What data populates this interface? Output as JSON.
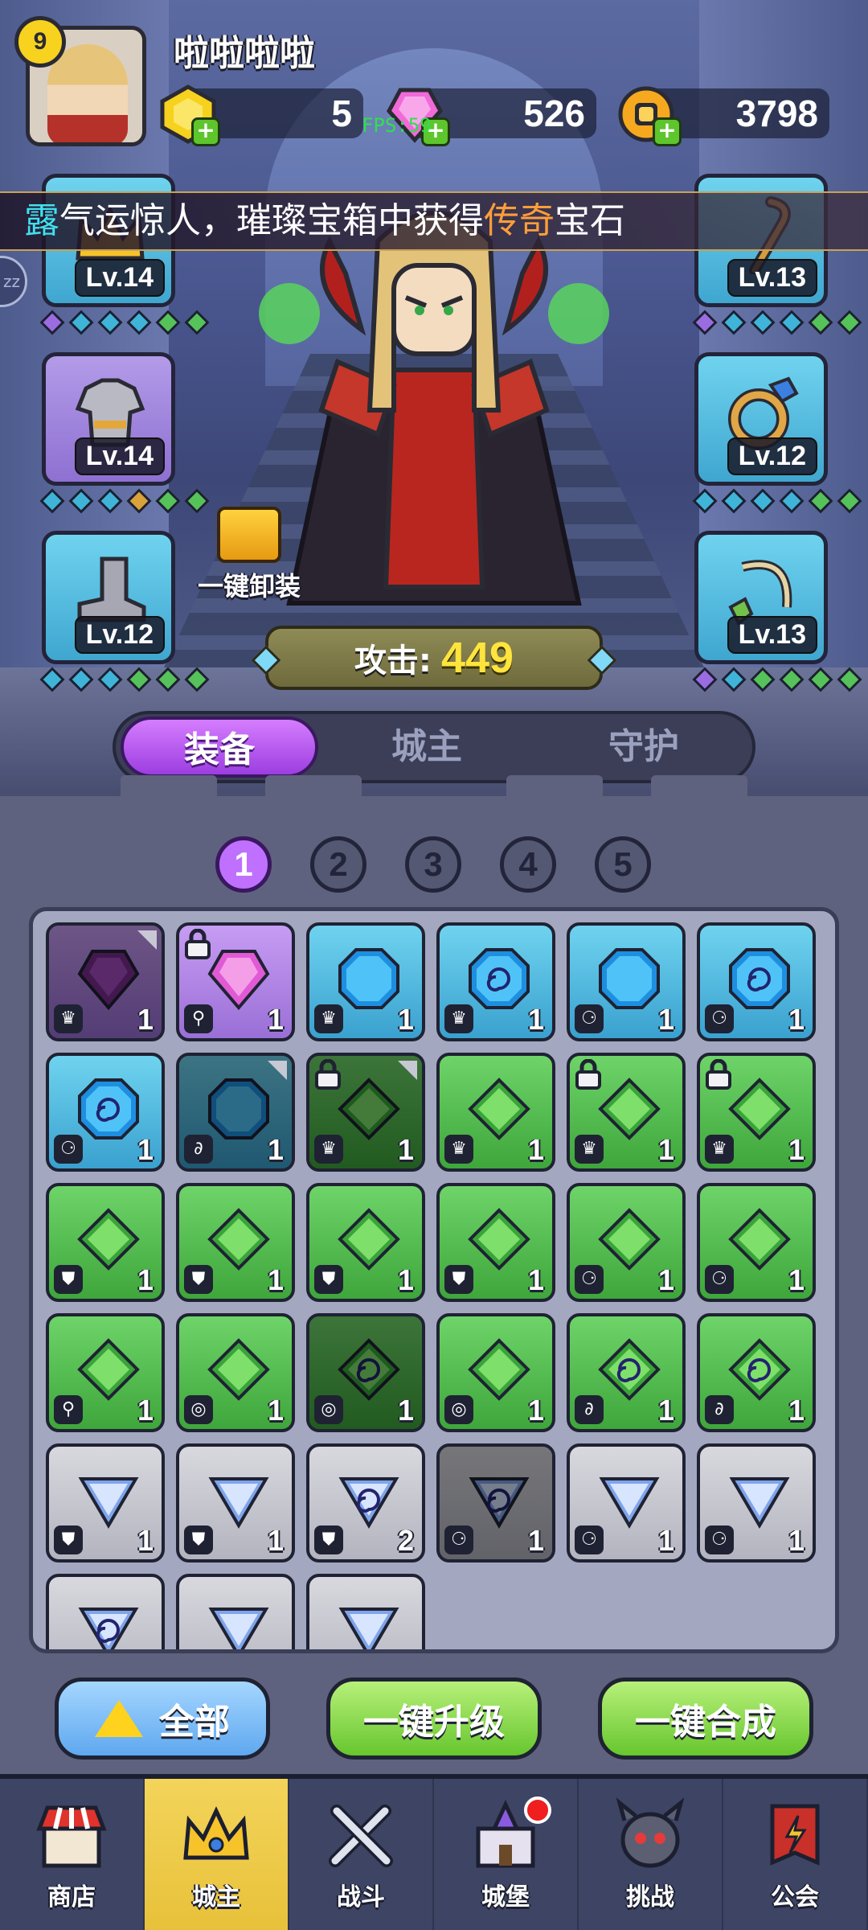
{
  "player": {
    "level": "9",
    "name": "啦啦啦啦"
  },
  "resources": [
    {
      "icon": "gold-hex-coin-icon",
      "value": "5"
    },
    {
      "icon": "pink-gem-icon",
      "value": "526"
    },
    {
      "icon": "gold-ring-coin-icon",
      "value": "3798"
    }
  ],
  "fps_label": "FPS:59",
  "marquee": {
    "prefix": "露",
    "middle": "气运惊人，璀璨宝箱中获得",
    "highlight": "传奇",
    "suffix": "宝石"
  },
  "side_pill": "zz",
  "equipment": {
    "left": [
      {
        "name": "crown",
        "level": "Lv.14",
        "rarity": "blue"
      },
      {
        "name": "armor",
        "level": "Lv.14",
        "rarity": "purple"
      },
      {
        "name": "boots",
        "level": "Lv.12",
        "rarity": "blue"
      }
    ],
    "right": [
      {
        "name": "staff",
        "level": "Lv.13",
        "rarity": "blue"
      },
      {
        "name": "ring",
        "level": "Lv.12",
        "rarity": "blue"
      },
      {
        "name": "amulet",
        "level": "Lv.13",
        "rarity": "blue"
      }
    ]
  },
  "unequip_label": "一键卸装",
  "attack": {
    "label": "攻击:",
    "value": "449"
  },
  "tabs": [
    "装备",
    "城主",
    "守护"
  ],
  "pages": [
    "1",
    "2",
    "3",
    "4",
    "5"
  ],
  "inventory": [
    {
      "rarity": "purple",
      "gem": "purple",
      "slot": "crown",
      "count": "1",
      "dim": true,
      "corner": true
    },
    {
      "rarity": "purple",
      "gem": "pink",
      "slot": "staff",
      "count": "1",
      "lock": true
    },
    {
      "rarity": "blue",
      "gem": "blue",
      "slot": "crown",
      "count": "1"
    },
    {
      "rarity": "blue",
      "gem": "blue-swirl",
      "slot": "crown",
      "count": "1"
    },
    {
      "rarity": "blue",
      "gem": "blue",
      "slot": "boots",
      "count": "1"
    },
    {
      "rarity": "blue",
      "gem": "blue-swirl",
      "slot": "boots",
      "count": "1"
    },
    {
      "rarity": "blue",
      "gem": "blue-swirl",
      "slot": "boots",
      "count": "1"
    },
    {
      "rarity": "blue",
      "gem": "blue",
      "slot": "amulet",
      "count": "1",
      "dim": true,
      "corner": true
    },
    {
      "rarity": "green",
      "gem": "green",
      "slot": "crown",
      "count": "1",
      "dim": true,
      "lock": true,
      "corner": true
    },
    {
      "rarity": "green",
      "gem": "green",
      "slot": "crown",
      "count": "1"
    },
    {
      "rarity": "green",
      "gem": "green",
      "slot": "crown",
      "count": "1",
      "lock": true
    },
    {
      "rarity": "green",
      "gem": "green",
      "slot": "crown",
      "count": "1",
      "lock": true
    },
    {
      "rarity": "green",
      "gem": "green",
      "slot": "armor",
      "count": "1"
    },
    {
      "rarity": "green",
      "gem": "green",
      "slot": "armor",
      "count": "1"
    },
    {
      "rarity": "green",
      "gem": "green",
      "slot": "armor",
      "count": "1"
    },
    {
      "rarity": "green",
      "gem": "green",
      "slot": "armor",
      "count": "1"
    },
    {
      "rarity": "green",
      "gem": "green",
      "slot": "boots",
      "count": "1"
    },
    {
      "rarity": "green",
      "gem": "green",
      "slot": "boots",
      "count": "1"
    },
    {
      "rarity": "green",
      "gem": "green",
      "slot": "staff",
      "count": "1"
    },
    {
      "rarity": "green",
      "gem": "green",
      "slot": "ring",
      "count": "1"
    },
    {
      "rarity": "green",
      "gem": "green-swirl",
      "slot": "ring",
      "count": "1",
      "dim": true
    },
    {
      "rarity": "green",
      "gem": "green",
      "slot": "ring",
      "count": "1"
    },
    {
      "rarity": "green",
      "gem": "green-swirl",
      "slot": "amulet",
      "count": "1"
    },
    {
      "rarity": "green",
      "gem": "green-swirl",
      "slot": "amulet",
      "count": "1"
    },
    {
      "rarity": "grey",
      "gem": "white",
      "slot": "armor",
      "count": "1"
    },
    {
      "rarity": "grey",
      "gem": "white",
      "slot": "armor",
      "count": "1"
    },
    {
      "rarity": "grey",
      "gem": "white-swirl",
      "slot": "armor",
      "count": "2"
    },
    {
      "rarity": "grey",
      "gem": "white-swirl",
      "slot": "boots",
      "count": "1",
      "dim": true
    },
    {
      "rarity": "grey",
      "gem": "white",
      "slot": "boots",
      "count": "1"
    },
    {
      "rarity": "grey",
      "gem": "white",
      "slot": "boots",
      "count": "1"
    },
    {
      "rarity": "grey",
      "gem": "white-swirl",
      "slot": "",
      "count": ""
    },
    {
      "rarity": "grey",
      "gem": "white",
      "slot": "",
      "count": ""
    },
    {
      "rarity": "grey",
      "gem": "white",
      "slot": "",
      "count": ""
    }
  ],
  "actions": {
    "all": "全部",
    "upgrade": "一键升级",
    "merge": "一键合成"
  },
  "nav": [
    {
      "label": "商店",
      "icon": "shop-icon"
    },
    {
      "label": "城主",
      "icon": "crown-icon",
      "active": true
    },
    {
      "label": "战斗",
      "icon": "crossed-swords-icon"
    },
    {
      "label": "城堡",
      "icon": "castle-icon",
      "badge": true
    },
    {
      "label": "挑战",
      "icon": "demon-helmet-icon"
    },
    {
      "label": "公会",
      "icon": "guild-banner-icon"
    }
  ],
  "colors": {
    "accent_purple": "#bf70ff",
    "attack_value": "#ffe43e",
    "marquee_highlight": "#ff9d3a",
    "marquee_name": "#40e0f0"
  }
}
